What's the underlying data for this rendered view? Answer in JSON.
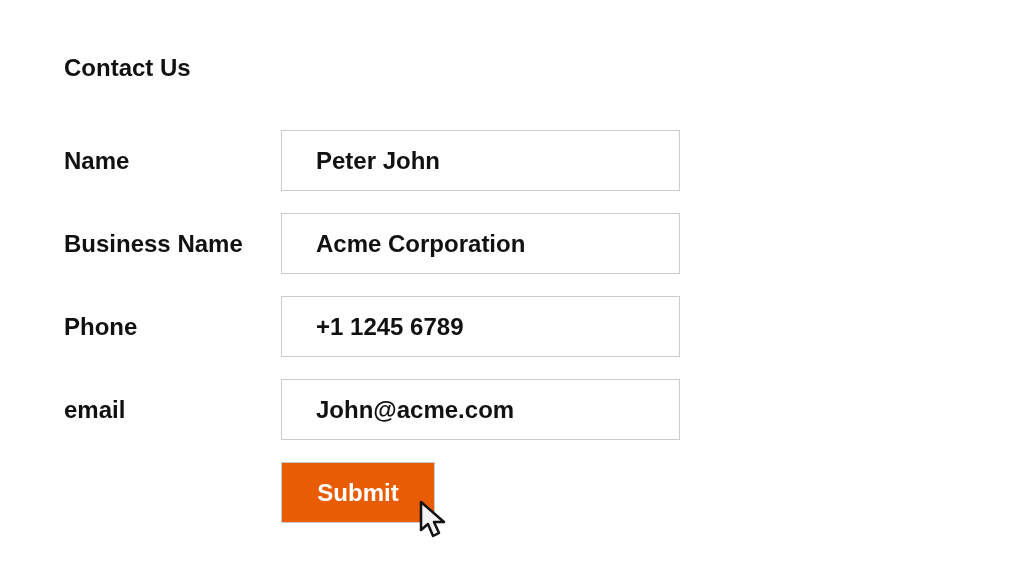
{
  "title": "Contact Us",
  "fields": [
    {
      "label": "Name",
      "value": "Peter John"
    },
    {
      "label": "Business Name",
      "value": "Acme Corporation"
    },
    {
      "label": "Phone",
      "value": "+1 1245 6789"
    },
    {
      "label": "email",
      "value": "John@acme.com"
    }
  ],
  "submit_button": "Submit"
}
